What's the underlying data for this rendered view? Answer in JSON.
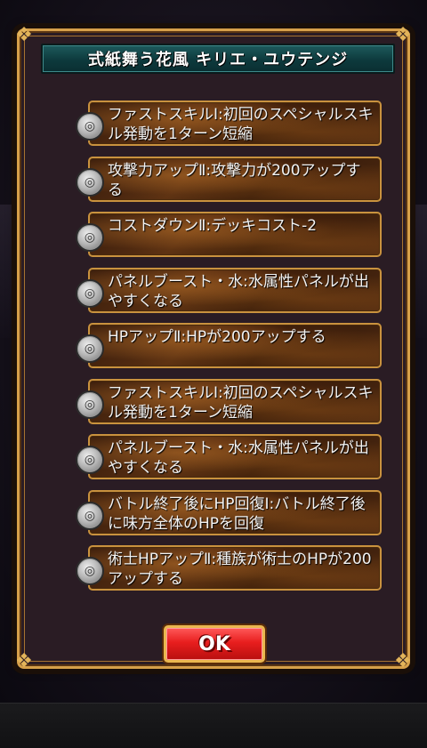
{
  "dialog": {
    "title": "式紙舞う花風 キリエ・ユウテンジ",
    "ok_label": "OK"
  },
  "skills": [
    {
      "icon": "skill-icon",
      "text": "ファストスキルⅠ:初回のスペシャルスキル発動を1ターン短縮"
    },
    {
      "icon": "skill-icon",
      "text": "攻撃力アップⅡ:攻撃力が200アップする"
    },
    {
      "icon": "skill-icon",
      "text": "コストダウンⅡ:デッキコスト-2"
    },
    {
      "icon": "skill-icon",
      "text": "パネルブースト・水:水属性パネルが出やすくなる"
    },
    {
      "icon": "skill-icon",
      "text": "HPアップⅡ:HPが200アップする"
    },
    {
      "icon": "skill-icon",
      "text": "ファストスキルⅠ:初回のスペシャルスキル発動を1ターン短縮"
    },
    {
      "icon": "skill-icon",
      "text": "パネルブースト・水:水属性パネルが出やすくなる"
    },
    {
      "icon": "skill-icon",
      "text": "バトル終了後にHP回復Ⅰ:バトル終了後に味方全体のHPを回復"
    },
    {
      "icon": "skill-icon",
      "text": "術士HPアップⅡ:種族が術士のHPが200アップする"
    }
  ]
}
